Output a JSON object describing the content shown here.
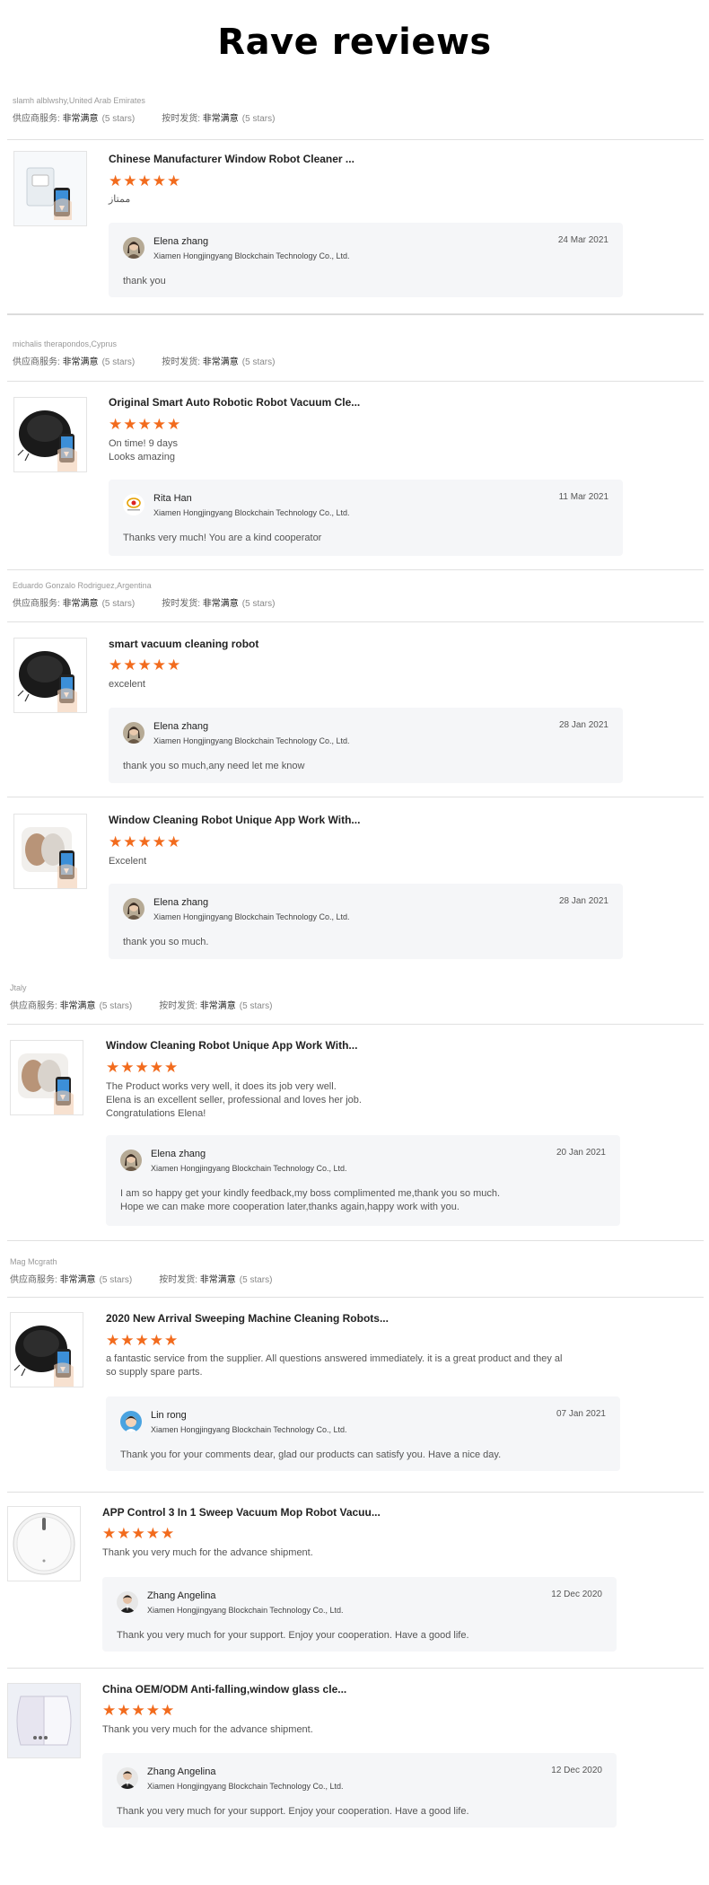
{
  "title": "Rave reviews",
  "ratings_labels": {
    "supplier_service": "供应商服务:",
    "on_time": "按时发货:",
    "value": "非常满意",
    "stars": "(5 stars)"
  },
  "star_glyphs": "★★★★★",
  "buyers": [
    {
      "name": "slamh alblwshy,United Arab Emirates"
    },
    {
      "name": "michalis therapondos,Cyprus"
    },
    {
      "name": "Eduardo Gonzalo Rodriguez,Argentina"
    },
    {
      "name": "Jtaly"
    },
    {
      "name": "Mag Mcgrath"
    }
  ],
  "reviews": [
    {
      "product": "Chinese Manufacturer Window Robot Cleaner ...",
      "rating": 5,
      "text": [
        "ممتاز"
      ],
      "reply": {
        "name": "Elena zhang",
        "company": "Xiamen Hongjingyang Blockchain Technology Co., Ltd.",
        "date": "24 Mar 2021",
        "message": [
          "thank you"
        ]
      }
    },
    {
      "product": "Original Smart Auto Robotic Robot Vacuum Cle...",
      "rating": 5,
      "text": [
        "On time! 9 days",
        "Looks amazing"
      ],
      "reply": {
        "name": "Rita Han",
        "company": "Xiamen Hongjingyang Blockchain Technology Co., Ltd.",
        "date": "11 Mar 2021",
        "message": [
          "Thanks very much! You are a kind cooperator"
        ]
      }
    },
    {
      "product": "smart vacuum cleaning robot",
      "rating": 5,
      "text": [
        "excelent"
      ],
      "reply": {
        "name": "Elena zhang",
        "company": "Xiamen Hongjingyang Blockchain Technology Co., Ltd.",
        "date": "28 Jan 2021",
        "message": [
          "thank you so much,any need let me know"
        ]
      }
    },
    {
      "product": "Window Cleaning Robot Unique App Work With...",
      "rating": 5,
      "text": [
        "Excelent"
      ],
      "reply": {
        "name": "Elena zhang",
        "company": "Xiamen Hongjingyang Blockchain Technology Co., Ltd.",
        "date": "28 Jan 2021",
        "message": [
          "thank you so much."
        ]
      }
    },
    {
      "product": "Window Cleaning Robot Unique App Work With...",
      "rating": 5,
      "text": [
        "The Product works very well, it does its job very well.",
        "Elena is an excellent seller, professional and loves her job.",
        "Congratulations Elena!"
      ],
      "reply": {
        "name": "Elena zhang",
        "company": "Xiamen Hongjingyang Blockchain Technology Co., Ltd.",
        "date": "20 Jan 2021",
        "message": [
          "I am so happy get your kindly feedback,my boss complimented me,thank you so much.",
          "Hope we can make more cooperation later,thanks again,happy work with you."
        ]
      }
    },
    {
      "product": "2020 New Arrival Sweeping Machine Cleaning Robots...",
      "rating": 5,
      "text": [
        "a fantastic service from the supplier.  All questions answered immediately.  it is a great product and they al",
        "so supply spare parts."
      ],
      "reply": {
        "name": "Lin rong",
        "company": "Xiamen Hongjingyang Blockchain Technology Co., Ltd.",
        "date": "07 Jan 2021",
        "message": [
          "Thank you for your comments dear, glad our products can satisfy you.   Have a nice day."
        ]
      }
    },
    {
      "product": "APP Control 3 In 1 Sweep Vacuum Mop Robot Vacuu...",
      "rating": 5,
      "text": [
        "Thank you very much for the advance shipment."
      ],
      "reply": {
        "name": "Zhang Angelina",
        "company": "Xiamen Hongjingyang Blockchain Technology Co., Ltd.",
        "date": "12 Dec 2020",
        "message": [
          "Thank you very much for your support. Enjoy your cooperation. Have a good life."
        ]
      }
    },
    {
      "product": "China OEM/ODM Anti-falling,window glass cle...",
      "rating": 5,
      "text": [
        "Thank you very much for the advance shipment."
      ],
      "reply": {
        "name": "Zhang Angelina",
        "company": "Xiamen Hongjingyang Blockchain Technology Co., Ltd.",
        "date": "12 Dec 2020",
        "message": [
          "Thank you very much for your support. Enjoy your cooperation. Have a good life."
        ]
      }
    }
  ],
  "colors": {
    "star": "#f26b1d",
    "reply_bg": "#f5f6f8",
    "divider": "#e0e0e0"
  }
}
